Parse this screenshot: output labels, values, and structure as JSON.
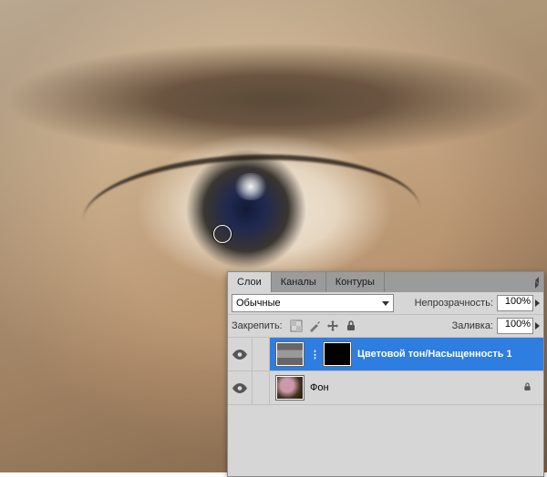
{
  "tabs": {
    "layers": "Слои",
    "channels": "Каналы",
    "paths": "Контуры"
  },
  "blend_mode": "Обычные",
  "opacity": {
    "label": "Непрозрачность:",
    "value": "100%"
  },
  "fill": {
    "label": "Заливка:",
    "value": "100%"
  },
  "lock_label": "Закрепить:",
  "layers": [
    {
      "name": "Цветовой тон/Насыщенность 1",
      "kind": "adjustment-hue-sat",
      "selected": true,
      "visible": true,
      "has_mask": true,
      "locked": false
    },
    {
      "name": "Фон",
      "kind": "background-image",
      "selected": false,
      "visible": true,
      "has_mask": false,
      "locked": true
    }
  ]
}
